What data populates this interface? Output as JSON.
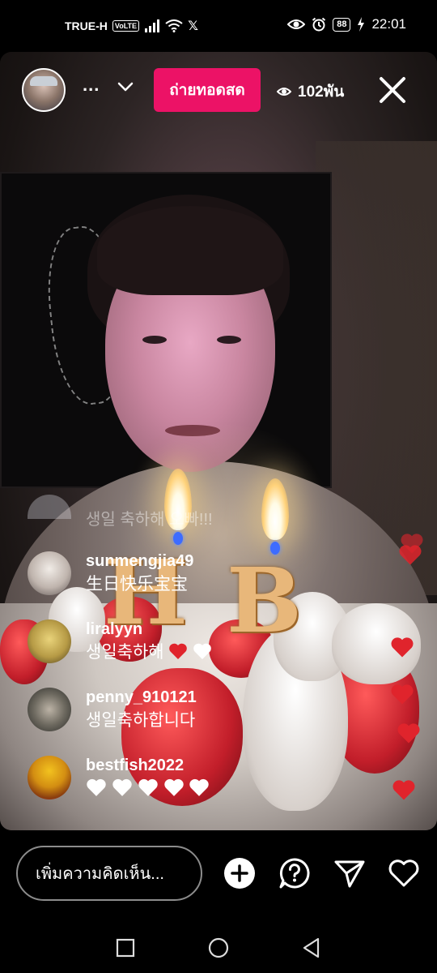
{
  "status_bar": {
    "carrier": "TRUE-H",
    "volte": "VoLTE",
    "x_logo": "𝕏",
    "battery": "88",
    "time": "22:01"
  },
  "header": {
    "more": "...",
    "live_label": "ถ่ายทอดสด",
    "viewer_count": "102พัน"
  },
  "comments": {
    "faded": "생일 축하해 오빠!!!",
    "items": [
      {
        "user": "sunmengjia49",
        "text": "生日快乐宝宝"
      },
      {
        "user": "liralyyn",
        "text": "생일축하해"
      },
      {
        "user": "penny_910121",
        "text": "생일축하합니다"
      },
      {
        "user": "bestfish2022",
        "text": ""
      }
    ]
  },
  "bottom_bar": {
    "comment_placeholder": "เพิ่มความคิดเห็น..."
  },
  "colors": {
    "live_badge": "#ec1266",
    "heart_red": "#e0242c",
    "background": "#000000"
  },
  "icons": [
    "signal-icon",
    "wifi-icon",
    "eye-icon",
    "alarm-icon",
    "charging-icon",
    "chevron-down-icon",
    "close-icon",
    "add-icon",
    "question-icon",
    "send-icon",
    "heart-icon",
    "nav-back-icon",
    "nav-home-icon",
    "nav-recents-icon"
  ]
}
